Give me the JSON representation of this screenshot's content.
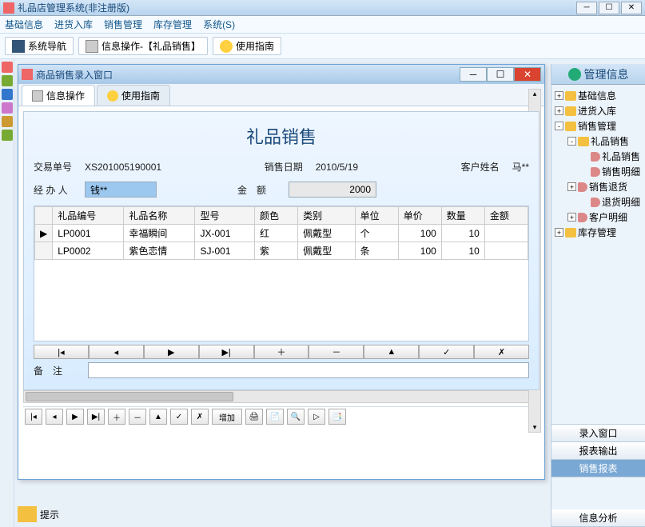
{
  "app": {
    "title": "礼品店管理系统(非注册版)"
  },
  "menu": [
    "基础信息",
    "进货入库",
    "销售管理",
    "库存管理",
    "系统(S)"
  ],
  "toolbar": {
    "nav": "系统导航",
    "info": "信息操作-【礼品销售】",
    "help": "使用指南"
  },
  "child": {
    "title": "商品销售录入窗口",
    "tabs": {
      "info": "信息操作",
      "help": "使用指南"
    },
    "form": {
      "title": "礼品销售",
      "orderLabel": "交易单号",
      "orderNo": "XS201005190001",
      "dateLabel": "销售日期",
      "dateVal": "2010/5/19",
      "custLabel": "客户姓名",
      "custVal": "马**",
      "operLabel": "经 办 人",
      "operVal": "钱**",
      "amtLabel": "金　额",
      "amtVal": "2000"
    },
    "cols": [
      "礼品编号",
      "礼品名称",
      "型号",
      "颜色",
      "类别",
      "单位",
      "单价",
      "数量",
      "金额"
    ],
    "rows": [
      {
        "mark": "▶",
        "c": [
          "LP0001",
          "幸福瞬间",
          "JX-001",
          "红",
          "佩戴型",
          "个",
          "100",
          "10",
          ""
        ]
      },
      {
        "mark": "",
        "c": [
          "LP0002",
          "紫色恋情",
          "SJ-001",
          "紫",
          "佩戴型",
          "条",
          "100",
          "10",
          ""
        ]
      }
    ],
    "nav": [
      "|◂",
      "◂",
      "▶",
      "▶|",
      "＋",
      "－",
      "▲",
      "✓",
      "✗"
    ],
    "remarkLabel": "备　注",
    "bottom": {
      "add": "增加",
      "icons": [
        "|◂",
        "◂",
        "▶",
        "▶|",
        "＋",
        "－",
        "▲",
        "✓",
        "✗"
      ]
    }
  },
  "right": {
    "header": "管理信息",
    "tree": [
      {
        "lvl": 1,
        "exp": "+",
        "type": "fold",
        "label": "基础信息"
      },
      {
        "lvl": 1,
        "exp": "+",
        "type": "fold",
        "label": "进货入库"
      },
      {
        "lvl": 1,
        "exp": "-",
        "type": "fold",
        "label": "销售管理"
      },
      {
        "lvl": 2,
        "exp": "-",
        "type": "fold",
        "label": "礼品销售"
      },
      {
        "lvl": 3,
        "exp": "",
        "type": "leaf",
        "label": "礼品销售"
      },
      {
        "lvl": 3,
        "exp": "",
        "type": "leaf",
        "label": "销售明细"
      },
      {
        "lvl": 2,
        "exp": "+",
        "type": "leaf",
        "label": "销售退货"
      },
      {
        "lvl": 3,
        "exp": "",
        "type": "leaf",
        "label": "退货明细"
      },
      {
        "lvl": 2,
        "exp": "+",
        "type": "leaf",
        "label": "客户明细"
      },
      {
        "lvl": 1,
        "exp": "+",
        "type": "fold",
        "label": "库存管理"
      }
    ],
    "sections": {
      "entry": "录入窗口",
      "report": "报表输出",
      "saleReport": "销售报表",
      "analysis": "信息分析"
    }
  },
  "tip": "提示"
}
